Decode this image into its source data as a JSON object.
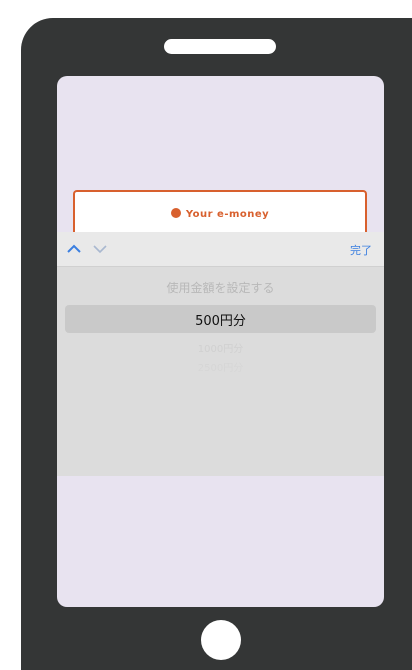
{
  "card": {
    "title": "Your e-money",
    "accent_color": "#d8602e"
  },
  "picker": {
    "done_label": "完了",
    "prev_icon": "chevron-up-icon",
    "next_icon": "chevron-down-icon",
    "header": "使用金額を設定する",
    "options": [
      "500円分",
      "1000円分",
      "2500円分"
    ],
    "selected": "500円分"
  },
  "colors": {
    "device": "#343636",
    "screen_bg": "#e8e3f0",
    "picker_bg": "#dcdcdc",
    "link": "#3b7fe0"
  }
}
